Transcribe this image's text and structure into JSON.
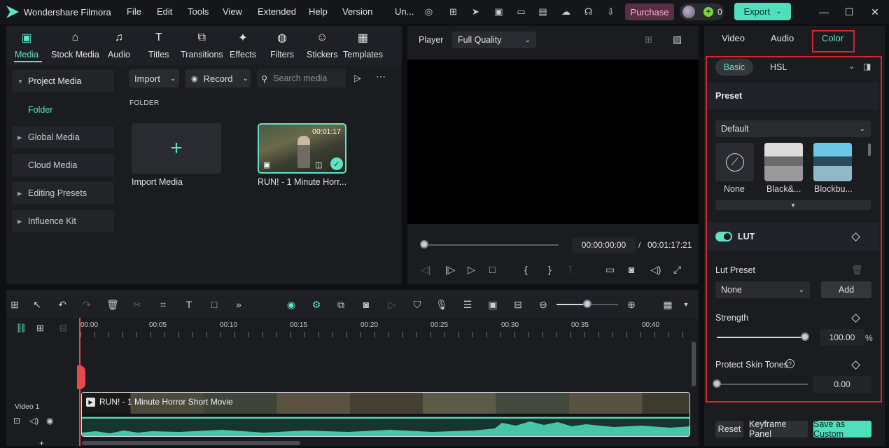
{
  "app": {
    "title": "Wondershare Filmora"
  },
  "menu": [
    "File",
    "Edit",
    "Tools",
    "View",
    "Extended",
    "Help",
    "Version",
    "Un..."
  ],
  "header": {
    "purchase": "Purchase",
    "coins": "0",
    "export": "Export"
  },
  "media_tabs": [
    {
      "label": "Media",
      "icon": "media-icon"
    },
    {
      "label": "Stock Media",
      "icon": "stock-media-icon"
    },
    {
      "label": "Audio",
      "icon": "audio-icon"
    },
    {
      "label": "Titles",
      "icon": "titles-icon"
    },
    {
      "label": "Transitions",
      "icon": "transitions-icon"
    },
    {
      "label": "Effects",
      "icon": "effects-icon"
    },
    {
      "label": "Filters",
      "icon": "filters-icon"
    },
    {
      "label": "Stickers",
      "icon": "stickers-icon"
    },
    {
      "label": "Templates",
      "icon": "templates-icon"
    }
  ],
  "sidebar": {
    "project_media": "Project Media",
    "folder": "Folder",
    "global_media": "Global Media",
    "cloud_media": "Cloud Media",
    "editing_presets": "Editing Presets",
    "influence_kit": "Influence Kit"
  },
  "media": {
    "import": "Import",
    "record": "Record",
    "search_placeholder": "Search media",
    "folder_label": "FOLDER",
    "import_tile": "Import Media",
    "clip_name": "RUN! - 1 Minute Horr...",
    "clip_duration": "00:01:17"
  },
  "player": {
    "label": "Player",
    "quality": "Full Quality",
    "current_time": "00:00:00:00",
    "separator": "/",
    "total_time": "00:01:17:21"
  },
  "right_panel": {
    "tabs": [
      "Video",
      "Audio",
      "Color"
    ],
    "active_tab": "Color",
    "basic": "Basic",
    "hsl": "HSL",
    "preset_section": "Preset",
    "preset_default": "Default",
    "presets": [
      "None",
      "Black&...",
      "Blockbu..."
    ],
    "lut": "LUT",
    "lut_preset_label": "Lut Preset",
    "lut_preset_value": "None",
    "add": "Add",
    "strength_label": "Strength",
    "strength_value": "100.00",
    "strength_unit": "%",
    "strength_fraction": 1.0,
    "protect_label": "Protect Skin Tones",
    "protect_value": "0.00",
    "protect_fraction": 0.0,
    "reset": "Reset",
    "keyframe_panel": "Keyframe Panel",
    "save_custom": "Save as Custom",
    "highlight_color": "#d4262e",
    "accent_color": "#5fe3c6"
  },
  "timeline": {
    "ruler": [
      "00:00",
      "00:05",
      "00:10",
      "00:15",
      "00:20",
      "00:25",
      "00:30",
      "00:35",
      "00:40"
    ],
    "track_name": "Video 1",
    "clip_title": "RUN! - 1 Minute Horror Short Movie"
  }
}
